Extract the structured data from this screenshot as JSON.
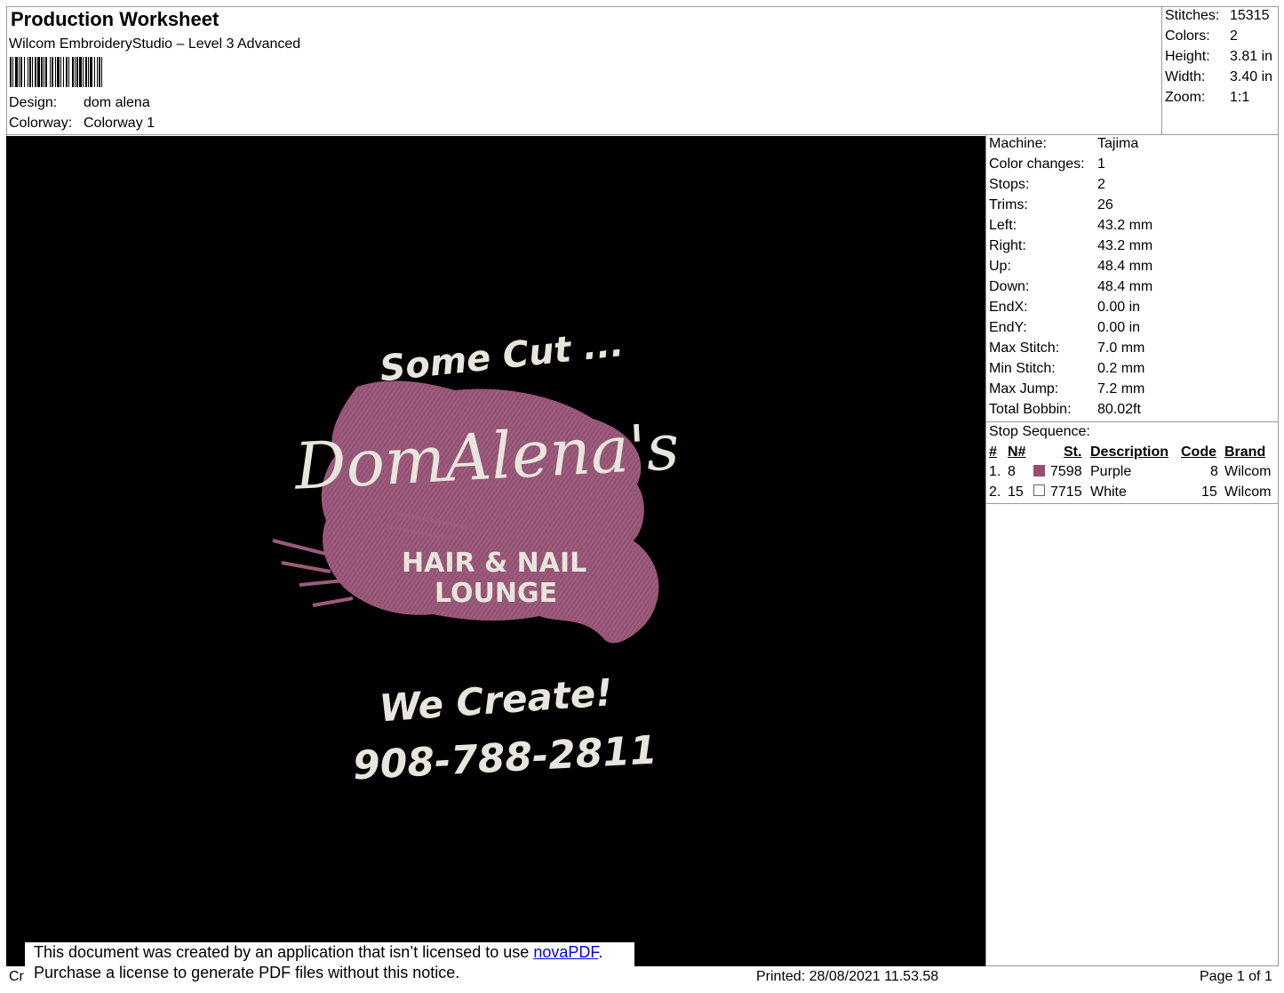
{
  "header": {
    "title": "Production Worksheet",
    "subtitle": "Wilcom EmbroideryStudio – Level 3 Advanced",
    "design_label": "Design:",
    "design_value": "dom alena",
    "colorway_label": "Colorway:",
    "colorway_value": "Colorway 1"
  },
  "summary": [
    {
      "label": "Stitches:",
      "value": "15315"
    },
    {
      "label": "Colors:",
      "value": "2"
    },
    {
      "label": "Height:",
      "value": "3.81 in"
    },
    {
      "label": "Width:",
      "value": "3.40 in"
    },
    {
      "label": "Zoom:",
      "value": "1:1"
    }
  ],
  "machine_info": [
    {
      "label": "Machine:",
      "value": "Tajima"
    },
    {
      "label": "Color changes:",
      "value": "1"
    },
    {
      "label": "Stops:",
      "value": "2"
    },
    {
      "label": "Trims:",
      "value": "26"
    },
    {
      "label": "Left:",
      "value": "43.2 mm"
    },
    {
      "label": "Right:",
      "value": "43.2 mm"
    },
    {
      "label": "Up:",
      "value": "48.4 mm"
    },
    {
      "label": "Down:",
      "value": "48.4 mm"
    },
    {
      "label": "EndX:",
      "value": "0.00 in"
    },
    {
      "label": "EndY:",
      "value": "0.00 in"
    },
    {
      "label": "Max Stitch:",
      "value": "7.0 mm"
    },
    {
      "label": "Min Stitch:",
      "value": "0.2 mm"
    },
    {
      "label": "Max Jump:",
      "value": "7.2 mm"
    },
    {
      "label": "Total Bobbin:",
      "value": "80.02ft"
    }
  ],
  "stop_sequence": {
    "title": "Stop Sequence:",
    "columns": {
      "num": "#",
      "n": "N#",
      "st": "St.",
      "description": "Description",
      "code": "Code",
      "brand": "Brand"
    },
    "rows": [
      {
        "num": "1.",
        "n": "8",
        "color": "#9c4a6e",
        "st": "7598",
        "description": "Purple",
        "code": "8",
        "brand": "Wilcom"
      },
      {
        "num": "2.",
        "n": "15",
        "color": "#ffffff",
        "st": "7715",
        "description": "White",
        "code": "15",
        "brand": "Wilcom"
      }
    ]
  },
  "design_art": {
    "top_text": "Some Cut ...",
    "main_text": "DomAlena's",
    "sub_line1": "HAIR & NAIL",
    "sub_line2": "LOUNGE",
    "bottom_text": "We Create!",
    "phone": "908-788-2811",
    "thread_purple": "#9c5a7c",
    "thread_white": "#e8e6dc"
  },
  "footer": {
    "left_clip": "Cr",
    "notice_line1_prefix": "This document was created by an application that isn’t licensed to use ",
    "notice_link": "novaPDF",
    "notice_line1_suffix": ".",
    "notice_line2": "Purchase a license to generate PDF files without this notice.",
    "printed": "Printed: 28/08/2021 11.53.58",
    "page": "Page 1 of 1"
  }
}
